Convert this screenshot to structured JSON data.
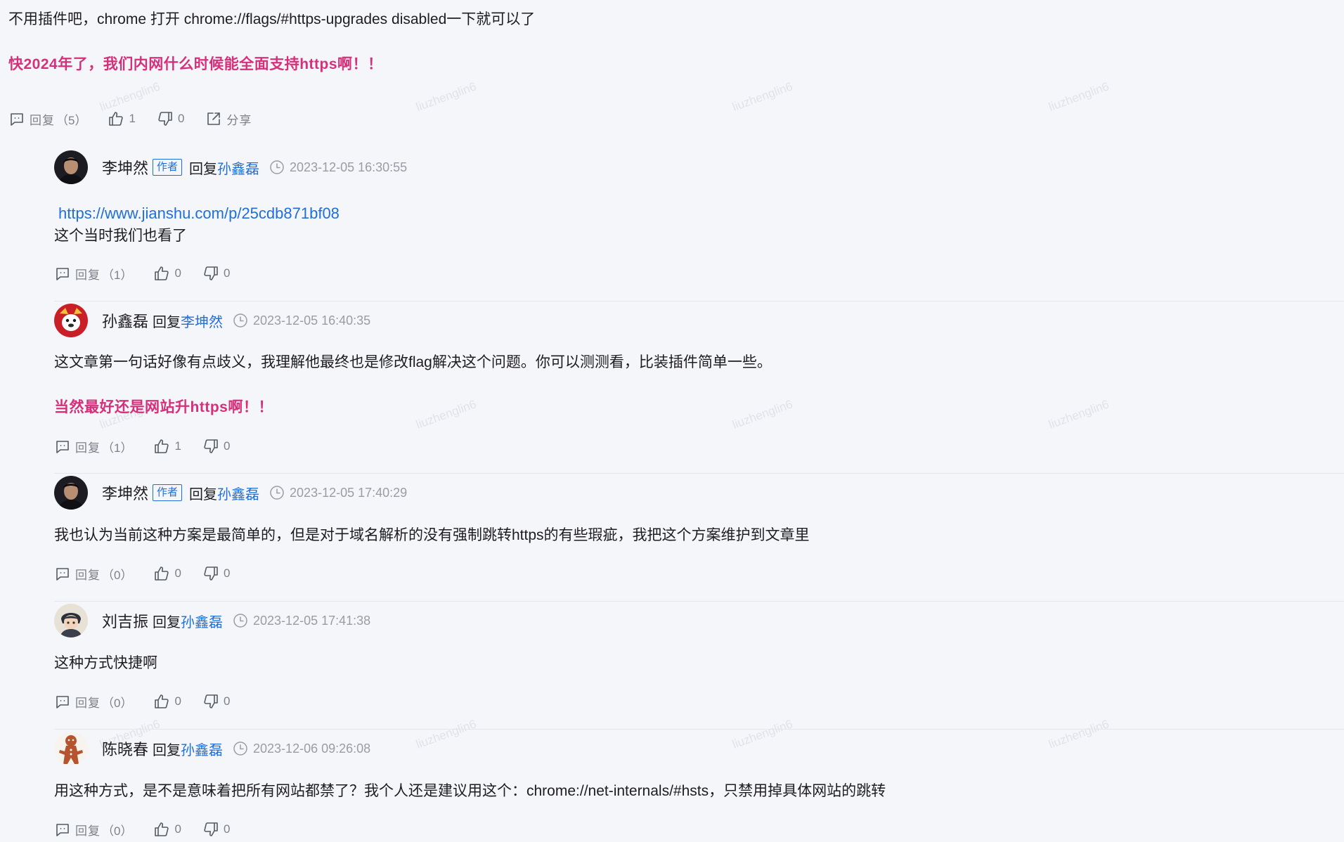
{
  "top_comment": {
    "text": "不用插件吧，chrome 打开 chrome://flags/#https-upgrades disabled一下就可以了",
    "highlight": "快2024年了，我们内网什么时候能全面支持https啊！！",
    "actions": {
      "reply_label": "回复",
      "reply_count": "（5）",
      "like_count": "1",
      "dislike_count": "0",
      "share_label": "分享"
    }
  },
  "watermark": "liuzhenglin6",
  "replies": [
    {
      "author": "李坤然",
      "badge": "作者",
      "reply_word": "回复",
      "reply_to": "孙鑫磊",
      "time": "2023-12-05 16:30:55",
      "link": "https://www.jianshu.com/p/25cdb871bf08",
      "text": "这个当时我们也看了",
      "reply_count": "（1）",
      "like_count": "0",
      "dislike_count": "0"
    },
    {
      "author": "孙鑫磊",
      "reply_word": "回复",
      "reply_to": "李坤然",
      "time": "2023-12-05 16:40:35",
      "text": "这文章第一句话好像有点歧义，我理解他最终也是修改flag解决这个问题。你可以测测看，比装插件简单一些。",
      "highlight": "当然最好还是网站升https啊！！",
      "reply_count": "（1）",
      "like_count": "1",
      "dislike_count": "0"
    },
    {
      "author": "李坤然",
      "badge": "作者",
      "reply_word": "回复",
      "reply_to": "孙鑫磊",
      "time": "2023-12-05 17:40:29",
      "text": "我也认为当前这种方案是最简单的，但是对于域名解析的没有强制跳转https的有些瑕疵，我把这个方案维护到文章里",
      "reply_count": "（0）",
      "like_count": "0",
      "dislike_count": "0"
    },
    {
      "author": "刘吉振",
      "reply_word": "回复",
      "reply_to": "孙鑫磊",
      "time": "2023-12-05 17:41:38",
      "text": "这种方式快捷啊",
      "reply_count": "（0）",
      "like_count": "0",
      "dislike_count": "0"
    },
    {
      "author": "陈晓春",
      "reply_word": "回复",
      "reply_to": "孙鑫磊",
      "time": "2023-12-06 09:26:08",
      "text": "用这种方式，是不是意味着把所有网站都禁了？我个人还是建议用这个：chrome://net-internals/#hsts，只禁用掉具体网站的跳转",
      "reply_count": "（0）",
      "like_count": "0",
      "dislike_count": "0"
    }
  ],
  "colors": {
    "background": "#f5f6fa",
    "highlight": "#d6307a",
    "link": "#1e6fd9",
    "muted": "#9a9ca5"
  }
}
